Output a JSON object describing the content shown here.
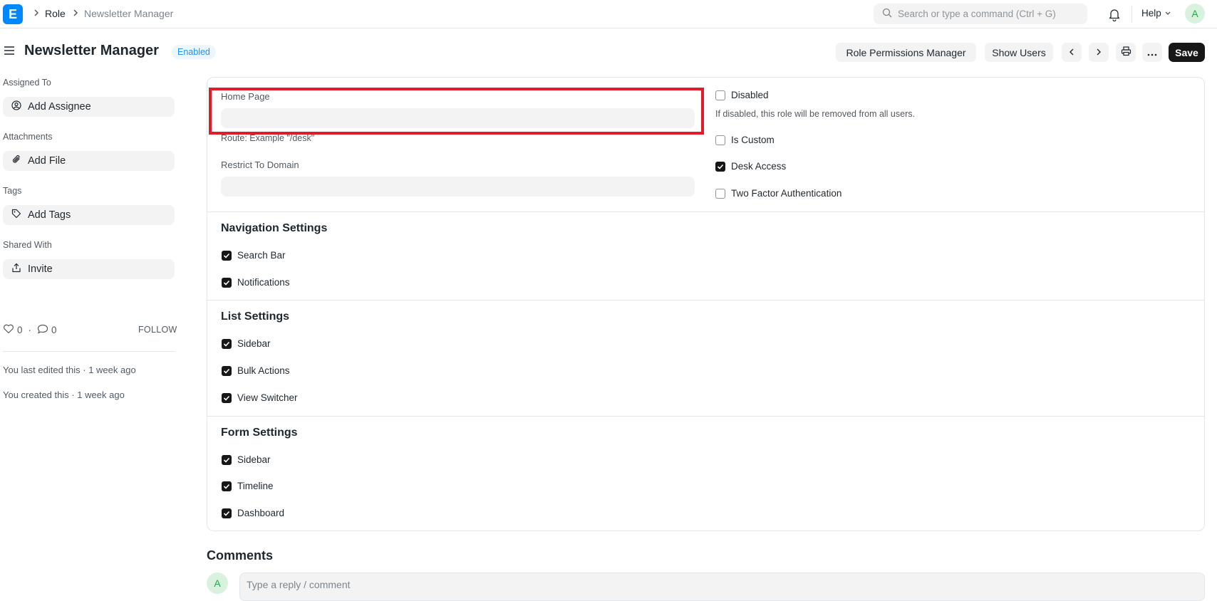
{
  "navbar": {
    "logo_letter": "E",
    "breadcrumbs": [
      "Role",
      "Newsletter Manager"
    ],
    "search_placeholder": "Search or type a command (Ctrl + G)",
    "help_label": "Help",
    "avatar_initial": "A"
  },
  "page": {
    "title": "Newsletter Manager",
    "status": "Enabled",
    "actions": {
      "role_permissions": "Role Permissions Manager",
      "show_users": "Show Users",
      "save": "Save"
    }
  },
  "sidebar": {
    "assigned_to_label": "Assigned To",
    "add_assignee": "Add Assignee",
    "attachments_label": "Attachments",
    "add_file": "Add File",
    "tags_label": "Tags",
    "add_tags": "Add Tags",
    "shared_with_label": "Shared With",
    "invite": "Invite",
    "likes": "0",
    "comments_count": "0",
    "follow": "FOLLOW",
    "last_edited": "You last edited this · 1 week ago",
    "created": "You created this · 1 week ago"
  },
  "form": {
    "home_page_label": "Home Page",
    "home_page_value": "",
    "home_page_desc": "Route: Example \"/desk\"",
    "restrict_domain_label": "Restrict To Domain",
    "restrict_domain_value": "",
    "disabled_label": "Disabled",
    "disabled_desc": "If disabled, this role will be removed from all users.",
    "is_custom_label": "Is Custom",
    "desk_access_label": "Desk Access",
    "two_factor_label": "Two Factor Authentication",
    "checks": {
      "disabled": false,
      "is_custom": false,
      "desk_access": true,
      "two_factor": false
    }
  },
  "navigation_settings": {
    "title": "Navigation Settings",
    "items": [
      {
        "label": "Search Bar",
        "checked": true
      },
      {
        "label": "Notifications",
        "checked": true
      }
    ]
  },
  "list_settings": {
    "title": "List Settings",
    "items": [
      {
        "label": "Sidebar",
        "checked": true
      },
      {
        "label": "Bulk Actions",
        "checked": true
      },
      {
        "label": "View Switcher",
        "checked": true
      }
    ]
  },
  "form_settings": {
    "title": "Form Settings",
    "items": [
      {
        "label": "Sidebar",
        "checked": true
      },
      {
        "label": "Timeline",
        "checked": true
      },
      {
        "label": "Dashboard",
        "checked": true
      }
    ]
  },
  "comments": {
    "title": "Comments",
    "avatar_initial": "A",
    "placeholder": "Type a reply / comment"
  },
  "colors": {
    "accent": "#0089ff",
    "highlight": "#e21b2a",
    "badge": "#2490ef",
    "primary_button": "#171717"
  }
}
